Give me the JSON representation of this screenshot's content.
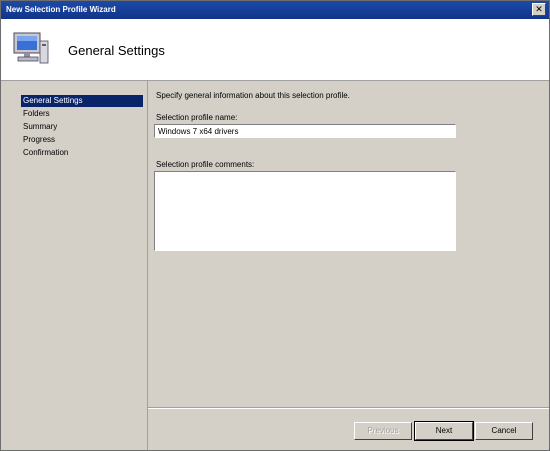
{
  "window": {
    "title": "New Selection Profile Wizard",
    "close_glyph": "✕"
  },
  "header": {
    "title": "General Settings",
    "icon": "computer-icon"
  },
  "sidebar": {
    "items": [
      {
        "label": "General Settings",
        "selected": true
      },
      {
        "label": "Folders",
        "selected": false
      },
      {
        "label": "Summary",
        "selected": false
      },
      {
        "label": "Progress",
        "selected": false
      },
      {
        "label": "Confirmation",
        "selected": false
      }
    ]
  },
  "content": {
    "instruction": "Specify general information about this selection profile.",
    "name_label": "Selection profile name:",
    "name_value": "Windows 7 x64 drivers",
    "comments_label": "Selection profile comments:",
    "comments_value": ""
  },
  "footer": {
    "previous_label": "Previous",
    "next_label": "Next",
    "cancel_label": "Cancel"
  },
  "colors": {
    "selection": "#0a246a",
    "titlebar": "#1c4aa8",
    "face": "#d4d0c8"
  }
}
